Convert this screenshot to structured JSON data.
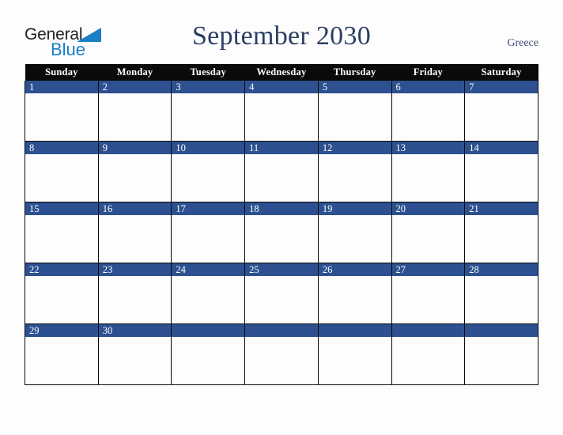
{
  "brand": {
    "name_part1": "General",
    "name_part2": "Blue",
    "triangle_icon": "triangle-icon",
    "colors": {
      "general_text": "#231f20",
      "blue_text": "#1b7fc3",
      "triangle": "#1b7fc3"
    }
  },
  "header": {
    "title": "September 2030",
    "country": "Greece",
    "title_color": "#2b3e63",
    "country_color": "#3d5178"
  },
  "calendar": {
    "month": "September",
    "year": "2030",
    "weekday_headers": [
      "Sunday",
      "Monday",
      "Tuesday",
      "Wednesday",
      "Thursday",
      "Friday",
      "Saturday"
    ],
    "colors": {
      "header_background": "#0a0a0a",
      "header_text": "#ffffff",
      "day_bar": "#2d5190",
      "day_number_text": "#ffffff",
      "cell_background": "#fdfdfd",
      "grid_line": "#0a0a0a",
      "page_background": "#fdfdfd"
    },
    "weeks": [
      [
        {
          "day": "1",
          "events": ""
        },
        {
          "day": "2",
          "events": ""
        },
        {
          "day": "3",
          "events": ""
        },
        {
          "day": "4",
          "events": ""
        },
        {
          "day": "5",
          "events": ""
        },
        {
          "day": "6",
          "events": ""
        },
        {
          "day": "7",
          "events": ""
        }
      ],
      [
        {
          "day": "8",
          "events": ""
        },
        {
          "day": "9",
          "events": ""
        },
        {
          "day": "10",
          "events": ""
        },
        {
          "day": "11",
          "events": ""
        },
        {
          "day": "12",
          "events": ""
        },
        {
          "day": "13",
          "events": ""
        },
        {
          "day": "14",
          "events": ""
        }
      ],
      [
        {
          "day": "15",
          "events": ""
        },
        {
          "day": "16",
          "events": ""
        },
        {
          "day": "17",
          "events": ""
        },
        {
          "day": "18",
          "events": ""
        },
        {
          "day": "19",
          "events": ""
        },
        {
          "day": "20",
          "events": ""
        },
        {
          "day": "21",
          "events": ""
        }
      ],
      [
        {
          "day": "22",
          "events": ""
        },
        {
          "day": "23",
          "events": ""
        },
        {
          "day": "24",
          "events": ""
        },
        {
          "day": "25",
          "events": ""
        },
        {
          "day": "26",
          "events": ""
        },
        {
          "day": "27",
          "events": ""
        },
        {
          "day": "28",
          "events": ""
        }
      ],
      [
        {
          "day": "29",
          "events": ""
        },
        {
          "day": "30",
          "events": ""
        },
        {
          "day": "",
          "events": ""
        },
        {
          "day": "",
          "events": ""
        },
        {
          "day": "",
          "events": ""
        },
        {
          "day": "",
          "events": ""
        },
        {
          "day": "",
          "events": ""
        }
      ]
    ]
  }
}
